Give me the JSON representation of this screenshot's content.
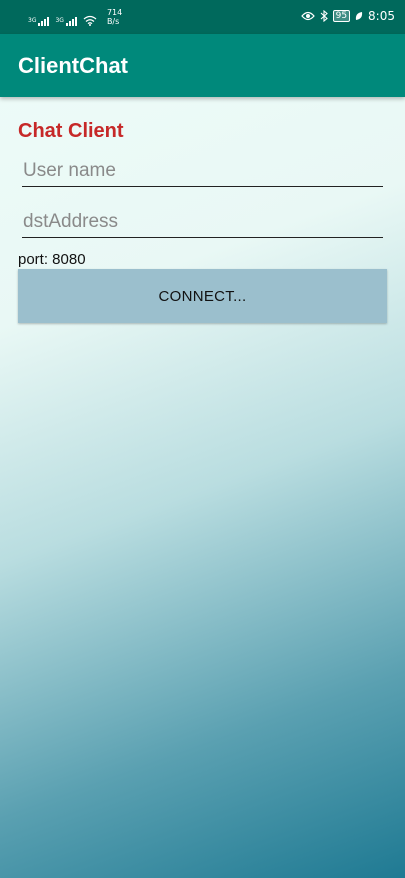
{
  "status_bar": {
    "sim1_tag": "3G",
    "sim2_tag": "3G",
    "net_speed_value": "714",
    "net_speed_unit": "B/s",
    "battery": "95",
    "time": "8:05",
    "icons": [
      "signal-icon",
      "signal-icon",
      "wifi-icon",
      "eye-icon",
      "bluetooth-icon",
      "battery-icon",
      "leaf-icon"
    ]
  },
  "app_bar": {
    "title": "ClientChat"
  },
  "main": {
    "heading": "Chat Client",
    "user_name": {
      "value": "",
      "placeholder": "User name"
    },
    "dst_address": {
      "value": "",
      "placeholder": "dstAddress"
    },
    "port_label": "port: 8080",
    "connect_label": "CONNECT..."
  },
  "colors": {
    "status_bar": "#00695c",
    "app_bar": "#00897b",
    "heading": "#c62828",
    "button": "#9bbfcd"
  }
}
